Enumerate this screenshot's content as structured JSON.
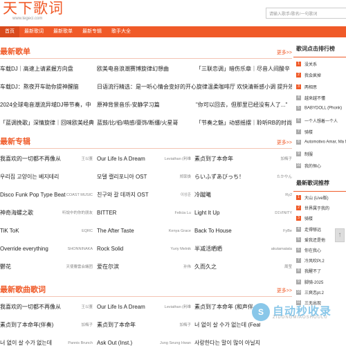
{
  "header": {
    "logo": "天下歌词",
    "logo_sub": "www.tegeci.com",
    "search_placeholder": "请输入歌手/歌名/一句歌词"
  },
  "nav": [
    "首页",
    "最新歌词",
    "最新歌单",
    "最新专辑",
    "歌手大全"
  ],
  "sections": [
    {
      "title": "最新歌单",
      "more": "更多>>",
      "rows": [
        [
          "车载DJ｜高速上请紧握方向盘",
          "欧美电音浪潮赛博旋律幻想曲",
          "「三联恋调」暗伤乐章｜尽音人间酸辛"
        ],
        [
          "车载DJ：熬夜开车助你提神醒脑",
          "日语流行精选：是一听心情会变好的开心旋律温柔咖啡厅 欢快清新感小调 提升效率",
          ""
        ],
        [
          "2024全球电音潮流异域DJ带节奏，中",
          "原神背景音乐-安静学习篇",
          "\"你可以回去，但那里已经没有人了...\""
        ],
        [
          "「蓝调挽歌」深情旋律｜回味欧美经典",
          "蓝鼓/比/伯/萌感/豪饰/断缰/火星哥",
          "「节奏之魅」动感摇摆｜聆听RB的时尚节拍"
        ]
      ]
    },
    {
      "title": "最新专辑",
      "more": "更多>>",
      "rows": [
        [
          {
            "n": "我喜欢的一切都不再像从",
            "a": "王以董"
          },
          {
            "n": "Our Life Is A Dream",
            "a": "Leviathan (利维"
          },
          {
            "n": "素贞到了本命年",
            "a": "加梅子"
          }
        ],
        [
          {
            "n": "우리집 고양이는 베지테리",
            "a": ""
          },
          {
            "n": "모델 캘리포니아 OST",
            "a": "郑荣焕"
          },
          {
            "n": "らいふずあびっち！",
            "a": "たかやん"
          }
        ],
        [
          {
            "n": "Disco Funk Pop Type Beat",
            "a": "COAST MUSIC"
          },
          {
            "n": "친구와 갈 데까지 OST",
            "a": "이상준"
          },
          {
            "n": "冷蹴曦",
            "a": "Ry2"
          }
        ],
        [
          {
            "n": "神奇海螺之歌",
            "a": "听說中的你的朋友人"
          },
          {
            "n": "BITTER",
            "a": "Felicia Lu"
          },
          {
            "n": "Light It Up",
            "a": "D1VINITY"
          }
        ],
        [
          {
            "n": "TiK ToK",
            "a": "EQRC"
          },
          {
            "n": "The After Taste",
            "a": "Kenya Grace"
          },
          {
            "n": "Back To House",
            "a": "FyBe"
          }
        ],
        [
          {
            "n": "Override everything",
            "a": "SHONNINAKA"
          },
          {
            "n": "Rock Solid",
            "a": "Yuriy Melnik"
          },
          {
            "n": "半减活晒晒",
            "a": "akutamatata"
          }
        ],
        [
          {
            "n": "鬱花",
            "a": "天使覆雲会議团"
          },
          {
            "n": "爱在尔滨",
            "a": "孙伟"
          },
          {
            "n": "久而久之",
            "a": "周莹"
          }
        ]
      ]
    },
    {
      "title": "最新歌曲歌词",
      "more": "更多>>",
      "rows": [
        [
          {
            "n": "我喜欢的一切都不再像从",
            "a": "王以董"
          },
          {
            "n": "Our Life Is A Dream",
            "a": "Leviathan (利维"
          },
          {
            "n": "素贞到了本命年 (和声伴",
            "a": ""
          }
        ],
        [
          {
            "n": "素贞到了本命年(伴奏)",
            "a": "加梅子"
          },
          {
            "n": "素贞到了本命年",
            "a": "加梅子"
          },
          {
            "n": "너 없이 살 수가 없는데 (Feat.",
            "a": ""
          }
        ],
        [
          {
            "n": "너 없이 살 수가 없는데",
            "a": "Pannis Brunch"
          },
          {
            "n": "Ask Out (Inst.)",
            "a": "Jung Seung Hwan"
          },
          {
            "n": "사랑한다는 말이 많이 아닐지는",
            "a": ""
          }
        ]
      ]
    }
  ],
  "sidebar": {
    "rank_title": "歌词点击排行榜",
    "rank": [
      "没关系",
      "我会疯掉",
      "两相思",
      "越来越不懂",
      "BABYDOLL (Phonk)",
      "一个人想着一个人",
      "骑楼",
      "Automotivo Amar, Ma Ma",
      "制服",
      "我的恒心"
    ],
    "rec_title": "最新歌词推荐",
    "rec": [
      "大山 (Live版)",
      "世界属于我的",
      "骑楼",
      "走得够远",
      "爱我还是他",
      "你在我心",
      "冷风吹Pt.2",
      "我醒不了",
      "脚骑-2025",
      "三爽恋pt.2",
      "三无出现"
    ]
  },
  "back_top": "↑",
  "watermark": {
    "logo": "S",
    "title": "自动秒收录",
    "sub": "ZIDONGMIAOSHOULU"
  }
}
